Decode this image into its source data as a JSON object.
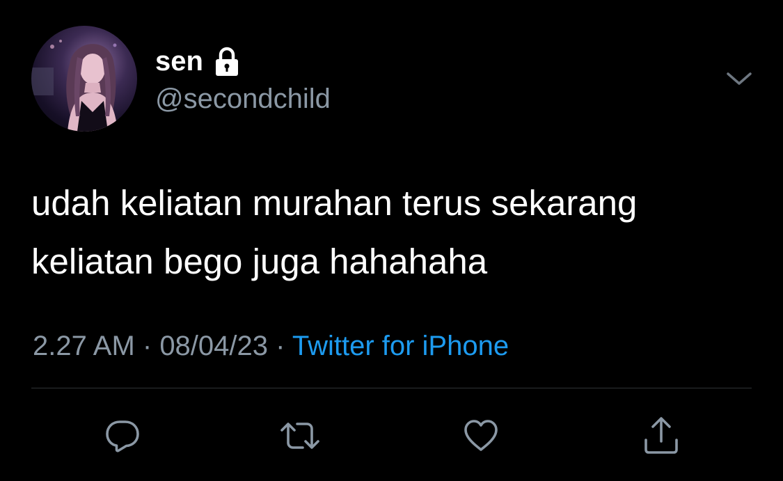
{
  "author": {
    "display_name": "sen",
    "handle": "@secondchild",
    "protected_icon": "lock-icon",
    "avatar": "avatar-photo"
  },
  "menu": {
    "icon": "chevron-down-icon"
  },
  "tweet": {
    "text_line_1": "udah keliatan murahan terus sekarang",
    "text_line_2": "keliatan bego juga hahahaha"
  },
  "meta": {
    "time": "2.27 AM",
    "separator": " · ",
    "date": "08/04/23",
    "source": "Twitter for iPhone"
  },
  "actions": [
    {
      "name": "reply",
      "icon": "reply-icon"
    },
    {
      "name": "retweet",
      "icon": "retweet-icon"
    },
    {
      "name": "like",
      "icon": "heart-icon"
    },
    {
      "name": "share",
      "icon": "share-icon"
    }
  ],
  "colors": {
    "background": "#000000",
    "primary_text": "#ffffff",
    "secondary_text": "#8b98a5",
    "link": "#1d9bf0",
    "divider": "#2f3336"
  }
}
